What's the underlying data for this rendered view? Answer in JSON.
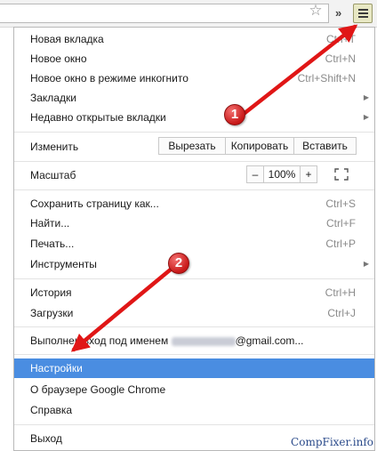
{
  "toolbar": {
    "star_icon": "star-icon",
    "overflow_glyph": "»",
    "menu_icon": "hamburger-menu-icon"
  },
  "menu": {
    "new_tab": {
      "label": "Новая вкладка",
      "shortcut": "Ctrl+T"
    },
    "new_window": {
      "label": "Новое окно",
      "shortcut": "Ctrl+N"
    },
    "incognito": {
      "label": "Новое окно в режиме инкогнито",
      "shortcut": "Ctrl+Shift+N"
    },
    "bookmarks": {
      "label": "Закладки"
    },
    "recent_tabs": {
      "label": "Недавно открытые вкладки"
    },
    "edit": {
      "label": "Изменить",
      "cut": "Вырезать",
      "copy": "Копировать",
      "paste": "Вставить"
    },
    "zoom": {
      "label": "Масштаб",
      "minus": "–",
      "value": "100%",
      "plus": "+"
    },
    "save_page": {
      "label": "Сохранить страницу как...",
      "shortcut": "Ctrl+S"
    },
    "find": {
      "label": "Найти...",
      "shortcut": "Ctrl+F"
    },
    "print": {
      "label": "Печать...",
      "shortcut": "Ctrl+P"
    },
    "tools": {
      "label": "Инструменты"
    },
    "history": {
      "label": "История",
      "shortcut": "Ctrl+H"
    },
    "downloads": {
      "label": "Загрузки",
      "shortcut": "Ctrl+J"
    },
    "signed_in": {
      "prefix": "Выполнен вход под именем",
      "suffix": "@gmail.com..."
    },
    "settings": {
      "label": "Настройки"
    },
    "about": {
      "label": "О браузере Google Chrome"
    },
    "help": {
      "label": "Справка"
    },
    "exit": {
      "label": "Выход"
    }
  },
  "annotations": {
    "badge1": "1",
    "badge2": "2",
    "arrow_color": "#e01616"
  },
  "watermark": "CompFixer.info",
  "colors": {
    "highlight": "#4a8de1"
  }
}
